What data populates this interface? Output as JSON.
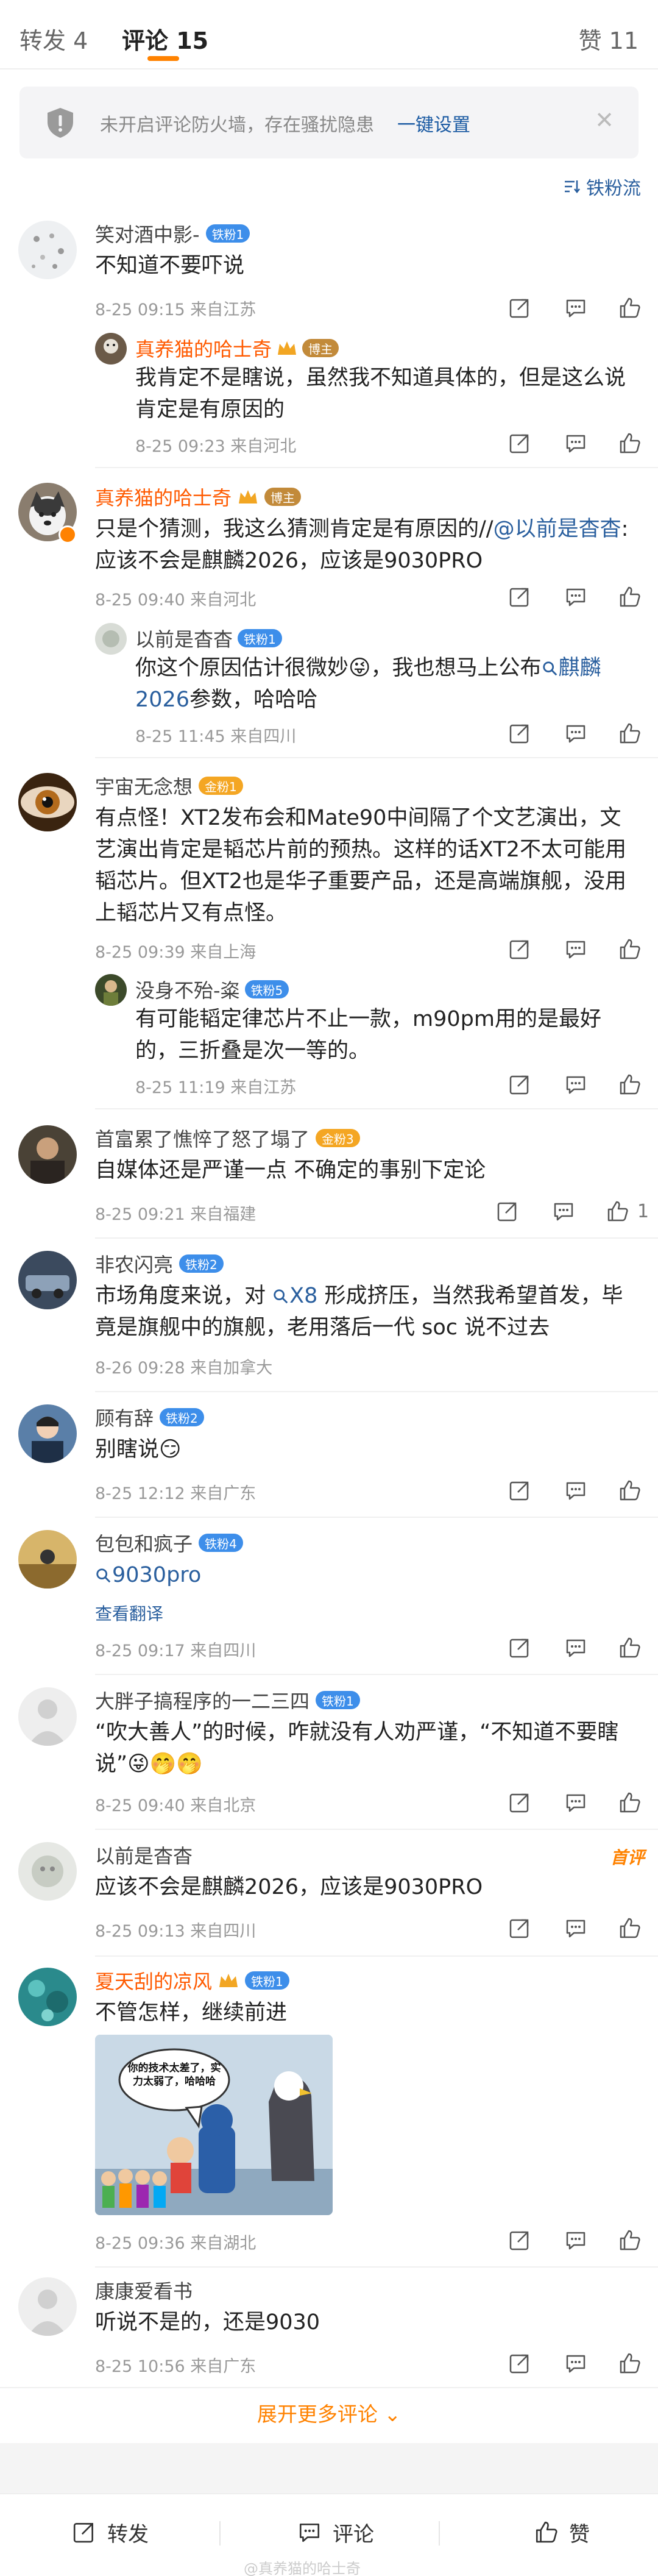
{
  "tabs": {
    "repost": "转发 4",
    "comments": "评论 15",
    "likes": "赞 11"
  },
  "notice": {
    "text": "未开启评论防火墙，存在骚扰隐患",
    "link": "一键设置",
    "close_icon": "close-icon"
  },
  "fan_sort": "铁粉流",
  "comments": [
    {
      "name": "笑对酒中影-",
      "badge": "铁粉1",
      "content": "不知道不要吓说",
      "meta": "8-25 09:15 来自江苏",
      "reply": {
        "name": "真养猫的哈士奇",
        "badge": "博主",
        "content": "我肯定不是瞎说，虽然我不知道具体的，但是这么说肯定是有原因的",
        "meta": "8-25 09:23 来自河北"
      }
    },
    {
      "name": "真养猫的哈士奇",
      "badge": "博主",
      "content_pre": "只是个猜测，我这么猜测肯定是有原因的//",
      "content_link": "@以前是杳杳",
      "content_post": ":应该不会是麒麟2026，应该是9030PRO",
      "meta": "8-25 09:40 来自河北",
      "reply": {
        "name": "以前是杳杳",
        "badge": "铁粉1",
        "content_pre": "你这个原因估计很微妙😜，我也想马上公布",
        "content_link": "麒麟2026",
        "content_post": "参数，哈哈哈",
        "meta": "8-25 11:45 来自四川"
      }
    },
    {
      "name": "宇宙无念想",
      "badge": "金粉1",
      "content": "有点怪！XT2发布会和Mate90中间隔了个文艺演出，文艺演出肯定是韬芯片前的预热。这样的话XT2不太可能用韬芯片。但XT2也是华子重要产品，还是高端旗舰，没用上韬芯片又有点怪。",
      "meta": "8-25 09:39 来自上海",
      "reply": {
        "name": "没身不殆-粢",
        "badge": "铁粉5",
        "content": "有可能韬定律芯片不止一款，m90pm用的是最好的，三折叠是次一等的。",
        "meta": "8-25 11:19 来自江苏"
      }
    },
    {
      "name": "首富累了憔悴了怒了塌了",
      "badge": "金粉3",
      "content": "自媒体还是严谨一点 不确定的事别下定论",
      "meta": "8-25 09:21 来自福建",
      "likes": "1"
    },
    {
      "name": "非农闪亮",
      "badge": "铁粉2",
      "content_pre": "市场角度来说，对 ",
      "content_link": "X8",
      "content_post": " 形成挤压，当然我希望首发，毕竟是旗舰中的旗舰，老用落后一代 soc 说不过去",
      "meta": "8-26 09:28 来自加拿大"
    },
    {
      "name": "顾有辞",
      "badge": "铁粉2",
      "content": "别瞎说😏",
      "meta": "8-25 12:12 来自广东"
    },
    {
      "name": "包包和疯子",
      "badge": "铁粉4",
      "content_link": "9030pro",
      "translate": "查看翻译",
      "meta": "8-25 09:17 来自四川"
    },
    {
      "name": "大胖子搞程序的一二三四",
      "badge": "铁粉1",
      "content": "“吹大善人”的时候，咋就没有人劝严谨，“不知道不要瞎说”😜🤭🤭",
      "meta": "8-25 09:40 来自北京"
    },
    {
      "name": "以前是杳杳",
      "hot": "首评",
      "content": "应该不会是麒麟2026，应该是9030PRO",
      "meta": "8-25 09:13 来自四川"
    },
    {
      "name": "夏天刮的凉风",
      "badge": "铁粉1",
      "content": "不管怎样，继续前进",
      "image_bubble": "你的技术太差了，实力太弱了，哈哈哈",
      "meta": "8-25 09:36 来自湖北"
    },
    {
      "name": "康康爱看书",
      "content": "听说不是的，还是9030",
      "meta": "8-25 10:56 来自广东"
    }
  ],
  "expand": "展开更多评论 ⌄",
  "bottom": {
    "repost": "转发",
    "comment": "评论",
    "like": "赞",
    "watermark": "@真养猫的哈士奇"
  },
  "colors": {
    "accent": "#ff8200",
    "link": "#2a5f9e",
    "vip_name": "#ff5a00"
  }
}
